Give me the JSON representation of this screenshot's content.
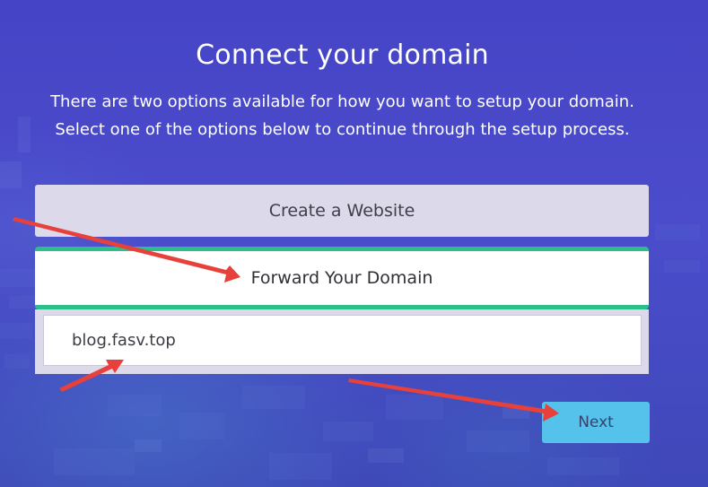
{
  "page": {
    "title": "Connect your domain",
    "description_line1": "There are two options available for how you want to setup your domain.",
    "description_line2": "Select one of the options below to continue through the setup process."
  },
  "options": {
    "create_website": "Create a Website",
    "forward_domain": "Forward Your Domain"
  },
  "domain_input": {
    "value": "blog.fasv.top"
  },
  "actions": {
    "next_label": "Next"
  },
  "colors": {
    "background": "#4544c6",
    "option_panel": "#dcd9ea",
    "selected_border": "#2bbf8a",
    "next_button": "#54c2ea",
    "annotation_arrow": "#e8403a"
  }
}
